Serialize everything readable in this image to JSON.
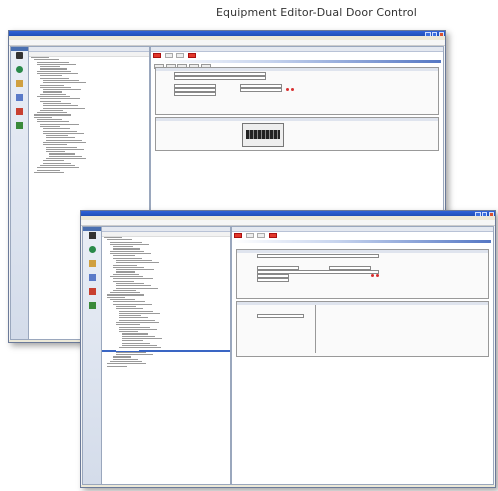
{
  "caption": "Equipment Editor-Dual Door Control",
  "colors": {
    "titlebar": "#2456c9",
    "accent_red": "#e2382b",
    "selection": "#3a66c4",
    "panel_border": "#9aa7bd"
  },
  "icons": [
    "window-minimize-icon",
    "window-maximize-icon",
    "window-close-icon",
    "navigation-module-icon",
    "tree-expand-icon",
    "delete-circle-icon"
  ]
}
